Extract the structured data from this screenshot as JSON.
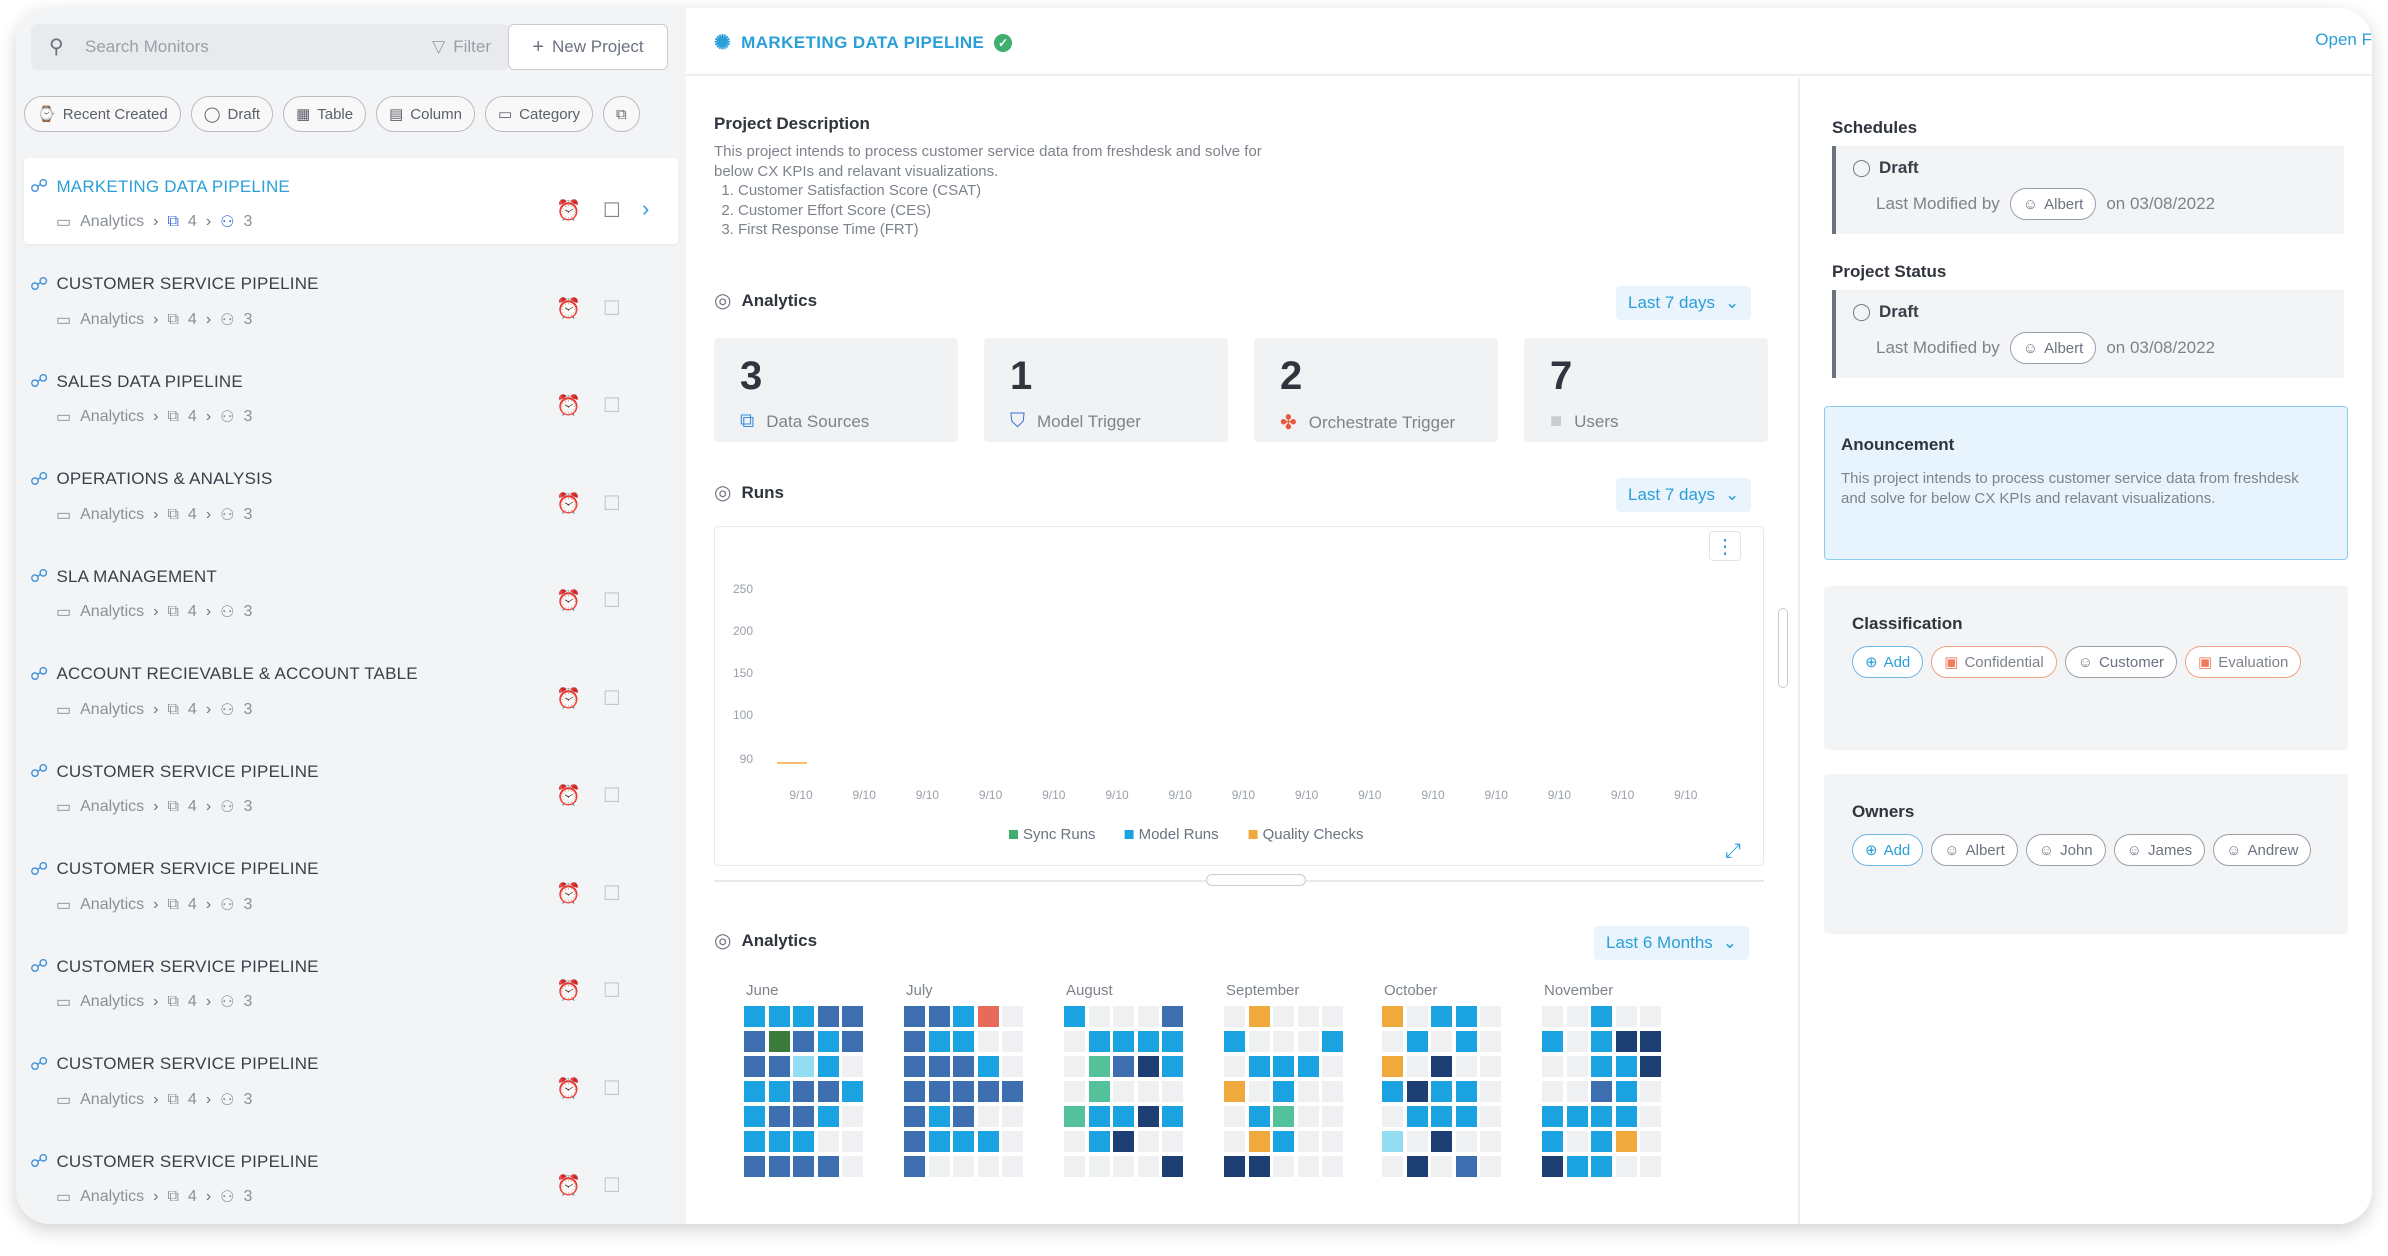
{
  "sidebar": {
    "search_placeholder": "Search Monitors",
    "filter_label": "Filter",
    "new_project_label": "New Project",
    "chips": [
      {
        "label": "Recent Created",
        "icon": "clock-icon"
      },
      {
        "label": "Draft",
        "icon": "draft-icon"
      },
      {
        "label": "Table",
        "icon": "table-icon"
      },
      {
        "label": "Column",
        "icon": "column-icon"
      },
      {
        "label": "Category",
        "icon": "folder-icon"
      },
      {
        "label": "",
        "icon": "copy-icon"
      }
    ],
    "items": [
      {
        "name": "MARKETING DATA PIPELINE",
        "folder": "Analytics",
        "sources": "4",
        "users": "3",
        "active": true
      },
      {
        "name": "CUSTOMER SERVICE PIPELINE",
        "folder": "Analytics",
        "sources": "4",
        "users": "3"
      },
      {
        "name": "SALES DATA PIPELINE",
        "folder": "Analytics",
        "sources": "4",
        "users": "3"
      },
      {
        "name": "OPERATIONS & ANALYSIS",
        "folder": "Analytics",
        "sources": "4",
        "users": "3"
      },
      {
        "name": "SLA MANAGEMENT",
        "folder": "Analytics",
        "sources": "4",
        "users": "3"
      },
      {
        "name": "ACCOUNT RECIEVABLE & ACCOUNT TABLE",
        "folder": "Analytics",
        "sources": "4",
        "users": "3"
      },
      {
        "name": "CUSTOMER SERVICE PIPELINE",
        "folder": "Analytics",
        "sources": "4",
        "users": "3"
      },
      {
        "name": "CUSTOMER SERVICE PIPELINE",
        "folder": "Analytics",
        "sources": "4",
        "users": "3"
      },
      {
        "name": "CUSTOMER SERVICE PIPELINE",
        "folder": "Analytics",
        "sources": "4",
        "users": "3"
      },
      {
        "name": "CUSTOMER SERVICE PIPELINE",
        "folder": "Analytics",
        "sources": "4",
        "users": "3"
      },
      {
        "name": "CUSTOMER SERVICE PIPELINE",
        "folder": "Analytics",
        "sources": "4",
        "users": "3"
      }
    ]
  },
  "header": {
    "title": "MARKETING DATA PIPELINE",
    "open_link": "Open F"
  },
  "description": {
    "title": "Project Description",
    "text": "This project intends to process customer service data from freshdesk and solve for below CX KPIs and relavant visualizations.",
    "kpis": [
      "Customer Satisfaction Score (CSAT)",
      "Customer Effort Score (CES)",
      "First Response Time (FRT)"
    ]
  },
  "analytics": {
    "title": "Analytics",
    "range": "Last 7 days",
    "stats": [
      {
        "value": "3",
        "label": "Data Sources",
        "icon": "data-sources-icon",
        "color": "#3b8fd9"
      },
      {
        "value": "1",
        "label": "Model Trigger",
        "icon": "model-trigger-icon",
        "color": "#3b6fd9"
      },
      {
        "value": "2",
        "label": "Orchestrate Trigger",
        "icon": "orchestrate-icon",
        "color": "#e55a3c"
      },
      {
        "value": "7",
        "label": "Users",
        "icon": "users-icon",
        "color": "#c9ccd1"
      }
    ]
  },
  "runs": {
    "title": "Runs",
    "range": "Last 7 days"
  },
  "chart_data": {
    "type": "line",
    "x": [
      "9/10",
      "9/10",
      "9/10",
      "9/10",
      "9/10",
      "9/10",
      "9/10",
      "9/10",
      "9/10",
      "9/10",
      "9/10",
      "9/10",
      "9/10",
      "9/10",
      "9/10"
    ],
    "yticks": [
      "250",
      "200",
      "150",
      "100",
      "90"
    ],
    "series": [
      {
        "name": "Sync Runs",
        "color": "#3fae6e",
        "values": []
      },
      {
        "name": "Model Runs",
        "color": "#1aa3e0",
        "values": []
      },
      {
        "name": "Quality Checks",
        "color": "#f0a93c",
        "values": []
      }
    ],
    "legend_position": "bottom"
  },
  "heatmap": {
    "title": "Analytics",
    "range": "Last 6 Months",
    "months": [
      "June",
      "July",
      "August",
      "September",
      "October",
      "November"
    ],
    "palette": {
      "a": "#1aa3e0",
      "b": "#3d6fb0",
      "c": "#1e3f73",
      "d": "#5fd0f0",
      "e": "#f0a93c",
      "f": "#e86b5a",
      "g": "#3a7a3a",
      "h": "#53c29a",
      "i": "#93ddf2",
      "o": "#eef0f2"
    },
    "grids": [
      [
        "aaabb",
        "bgbab",
        "bbiao",
        "aabba",
        "abbao",
        "aaaoo",
        "bbbbo"
      ],
      [
        "bbafo",
        "baaoo",
        "bbbao",
        "bbbbb",
        "baboo",
        "baaao",
        "boooo"
      ],
      [
        "aooob",
        "oaaaa",
        "ohbca",
        "ohooo",
        "haaca",
        "oacoo",
        "ooooc"
      ],
      [
        "oeooo",
        "aoooa",
        "oaaao",
        "eoaoo",
        "oahoo",
        "oeaoo",
        "ccooo"
      ],
      [
        "eoaao",
        "oaoao",
        "eocoo",
        "acaao",
        "oaaao",
        "iocoo",
        "ocobo"
      ],
      [
        "ooaoo",
        "aoacc",
        "ooaac",
        "oobao",
        "aaaao",
        "aoaeo",
        "caaoo"
      ]
    ]
  },
  "right_panel": {
    "schedules_title": "Schedules",
    "schedule_status": "Draft",
    "schedule_modified_by": "Last Modified by",
    "schedule_user": "Albert",
    "schedule_date": "on 03/08/2022",
    "status_title": "Project Status",
    "project_status": "Draft",
    "status_modified_by": "Last Modified by",
    "status_user": "Albert",
    "status_date": "on 03/08/2022",
    "announcement_title": "Anouncement",
    "announcement_text": "This project intends to process customer service data from freshdesk and solve for below CX KPIs and relavant visualizations.",
    "classification_title": "Classification",
    "classification_tags": [
      {
        "label": "Add",
        "style": "blue"
      },
      {
        "label": "Confidential",
        "style": "orange"
      },
      {
        "label": "Customer",
        "style": "grey"
      },
      {
        "label": "Evaluation",
        "style": "orange"
      }
    ],
    "owners_title": "Owners",
    "owners": [
      {
        "label": "Add",
        "style": "blue"
      },
      {
        "label": "Albert",
        "style": "grey"
      },
      {
        "label": "John",
        "style": "grey"
      },
      {
        "label": "James",
        "style": "grey"
      },
      {
        "label": "Andrew",
        "style": "grey"
      }
    ]
  }
}
